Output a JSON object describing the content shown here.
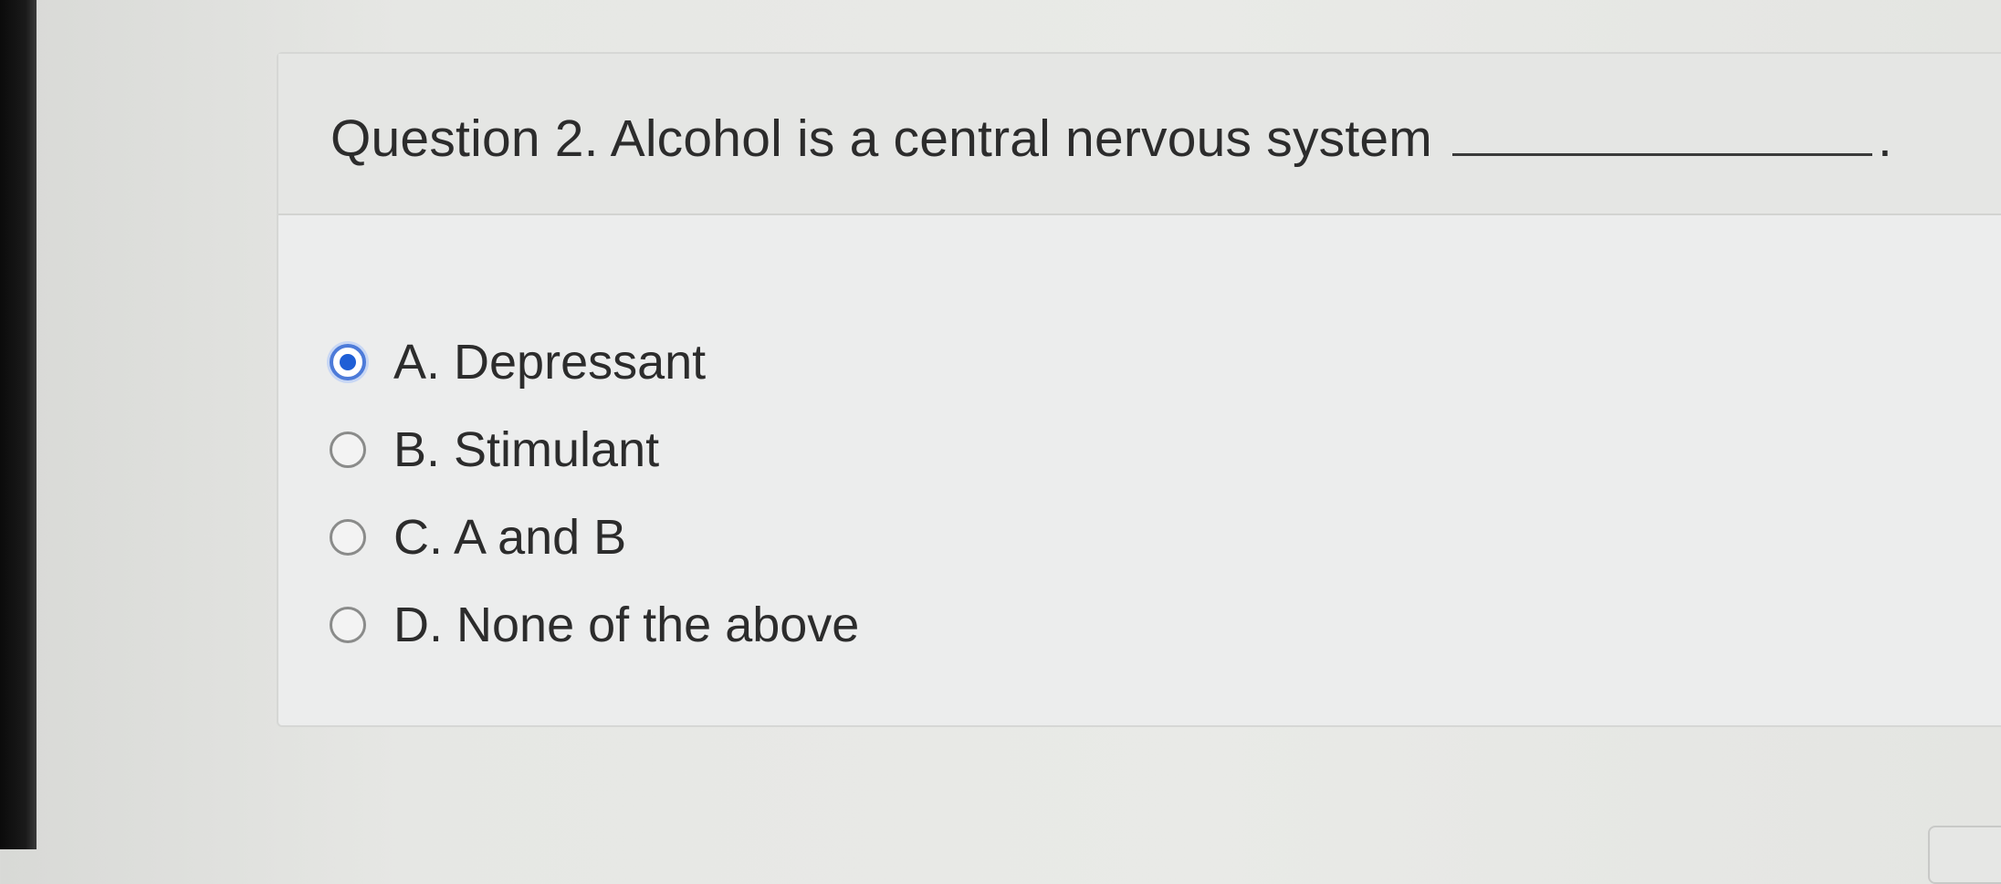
{
  "question": {
    "text": "Question 2. Alcohol is a central nervous system",
    "end_punctuation": "."
  },
  "options": [
    {
      "label": "A. Depressant",
      "selected": true
    },
    {
      "label": "B. Stimulant",
      "selected": false
    },
    {
      "label": "C. A and B",
      "selected": false
    },
    {
      "label": "D. None of the above",
      "selected": false
    }
  ],
  "colors": {
    "radio_selected": "#1f5fd6",
    "radio_ring": "#4d7bd9"
  }
}
